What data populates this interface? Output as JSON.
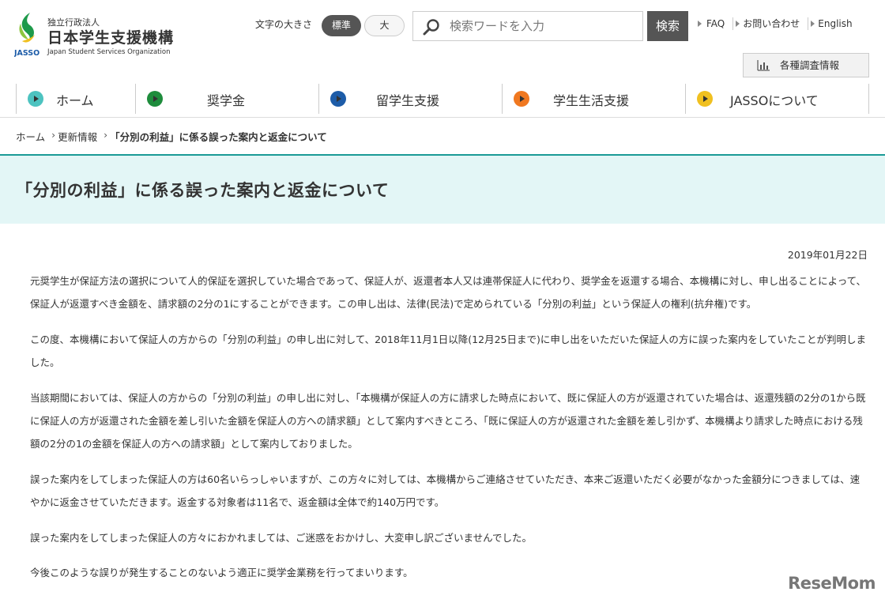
{
  "header": {
    "logo": {
      "small_text": "独立行政法人",
      "main_text": "日本学生支援機構",
      "en_text": "Japan Student Services Organization",
      "mark_text": "JASSO"
    },
    "font_size": {
      "label": "文字の大きさ",
      "standard": "標準",
      "large": "大"
    },
    "search": {
      "placeholder": "検索ワードを入力",
      "button": "検索"
    },
    "util_links": [
      "FAQ",
      "お問い合わせ",
      "English"
    ],
    "survey_button": "各種調査情報"
  },
  "gnav": [
    {
      "label": "ホーム",
      "color": "#4dc3c0"
    },
    {
      "label": "奨学金",
      "color": "#1e8c3c"
    },
    {
      "label": "留学生支援",
      "color": "#1d5ca8"
    },
    {
      "label": "学生生活支援",
      "color": "#f07820"
    },
    {
      "label": "JASSOについて",
      "color": "#f0c020"
    }
  ],
  "breadcrumb": [
    "ホーム",
    "更新情報",
    "「分別の利益」に係る誤った案内と返金について"
  ],
  "page": {
    "title": "「分別の利益」に係る誤った案内と返金について",
    "date": "2019年01月22日",
    "paragraphs": [
      "元奨学生が保証方法の選択について人的保証を選択していた場合であって、保証人が、返還者本人又は連帯保証人に代わり、奨学金を返還する場合、本機構に対し、申し出ることによって、保証人が返還すべき金額を、請求額の2分の1にすることができます。この申し出は、法律(民法)で定められている「分別の利益」という保証人の権利(抗弁権)です。",
      "この度、本機構において保証人の方からの「分別の利益」の申し出に対して、2018年11月1日以降(12月25日まで)に申し出をいただいた保証人の方に誤った案内をしていたことが判明しました。",
      "当該期間においては、保証人の方からの「分別の利益」の申し出に対し、「本機構が保証人の方に請求した時点において、既に保証人の方が返還されていた場合は、返還残額の2分の1から既に保証人の方が返還された金額を差し引いた金額を保証人の方への請求額」として案内すべきところ、「既に保証人の方が返還された金額を差し引かず、本機構より請求した時点における残額の2分の1の金額を保証人の方への請求額」として案内しておりました。",
      "誤った案内をしてしまった保証人の方は60名いらっしゃいますが、この方々に対しては、本機構からご連絡させていただき、本来ご返還いただく必要がなかった金額分につきましては、速やかに返金させていただきます。返金する対象者は11名で、返金額は全体で約140万円です。",
      "誤った案内をしてしまった保証人の方々におかれましては、ご迷惑をおかけし、大変申し訳ございませんでした。",
      "今後このような誤りが発生することのないよう適正に奨学金業務を行ってまいります。"
    ]
  },
  "watermark": "ReseMom"
}
